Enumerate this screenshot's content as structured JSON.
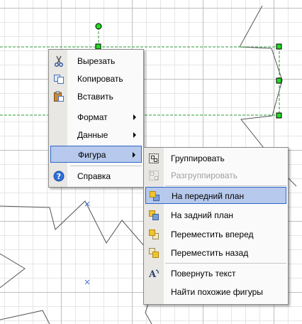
{
  "colors": {
    "selection_outline": "#2e9a3a",
    "handle_fill": "#22dd22",
    "highlight_fill": "#b7c9ec",
    "highlight_border": "#3168c8"
  },
  "context_menu": {
    "items": [
      {
        "label": "Вырезать",
        "icon": "scissors-icon"
      },
      {
        "label": "Копировать",
        "icon": "copy-icon"
      },
      {
        "label": "Вставить",
        "icon": "paste-icon"
      },
      {
        "label": "Формат",
        "submenu": true
      },
      {
        "label": "Данные",
        "submenu": true
      },
      {
        "label": "Фигура",
        "submenu": true,
        "highlighted": true
      },
      {
        "label": "Справка",
        "icon": "help-icon"
      }
    ]
  },
  "submenu": {
    "items": [
      {
        "label": "Группировать",
        "icon": "group-icon"
      },
      {
        "label": "Разгруппировать",
        "icon": "ungroup-icon",
        "disabled": true
      },
      {
        "label": "На передний план",
        "icon": "bring-to-front-icon",
        "highlighted": true
      },
      {
        "label": "На задний план",
        "icon": "send-to-back-icon"
      },
      {
        "label": "Переместить вперед",
        "icon": "bring-forward-icon"
      },
      {
        "label": "Переместить назад",
        "icon": "send-backward-icon"
      },
      {
        "label": "Повернуть текст",
        "icon": "rotate-text-icon"
      },
      {
        "label": "Найти похожие фигуры"
      }
    ]
  }
}
